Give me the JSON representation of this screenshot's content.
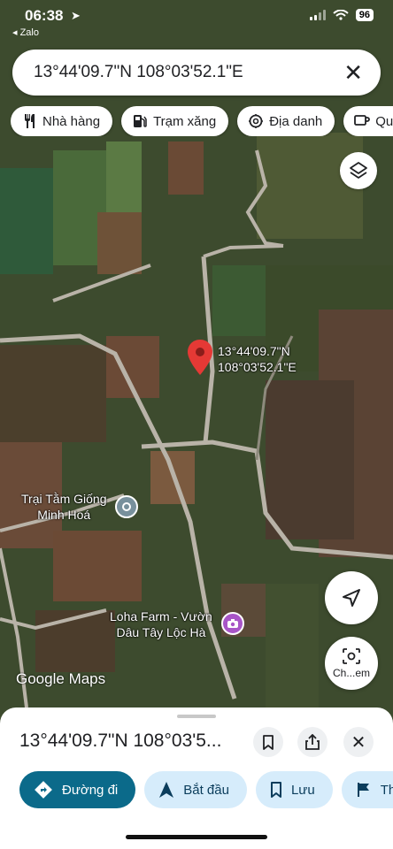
{
  "status_bar": {
    "time": "06:38",
    "back_app": "◂ Zalo",
    "battery": "96"
  },
  "search": {
    "query": "13°44'09.7\"N 108°03'52.1\"E"
  },
  "chips": [
    {
      "label": "Nhà hàng",
      "icon": "fork-knife-icon"
    },
    {
      "label": "Trạm xăng",
      "icon": "gas-pump-icon"
    },
    {
      "label": "Địa danh",
      "icon": "landmark-icon"
    },
    {
      "label": "Quá",
      "icon": "coffee-cup-icon"
    }
  ],
  "map": {
    "pin_label_line1": "13°44'09.7\"N",
    "pin_label_line2": "108°03'52.1\"E",
    "poi_trai_line1": "Trại Tằm Giống",
    "poi_trai_line2": "Minh Hoá",
    "poi_loha_line1": "Loha Farm - Vườn",
    "poi_loha_line2": "Dâu Tây Lộc Hà",
    "logo_google": "Google",
    "logo_maps": "Maps",
    "camera_label": "Ch...em"
  },
  "sheet": {
    "title": "13°44'09.7\"N 108°03'5...",
    "actions": [
      {
        "label": "Đường đi",
        "icon": "directions-icon"
      },
      {
        "label": "Bắt đầu",
        "icon": "navigation-arrow-icon"
      },
      {
        "label": "Lưu",
        "icon": "bookmark-icon"
      },
      {
        "label": "Th",
        "icon": "flag-icon"
      }
    ]
  }
}
